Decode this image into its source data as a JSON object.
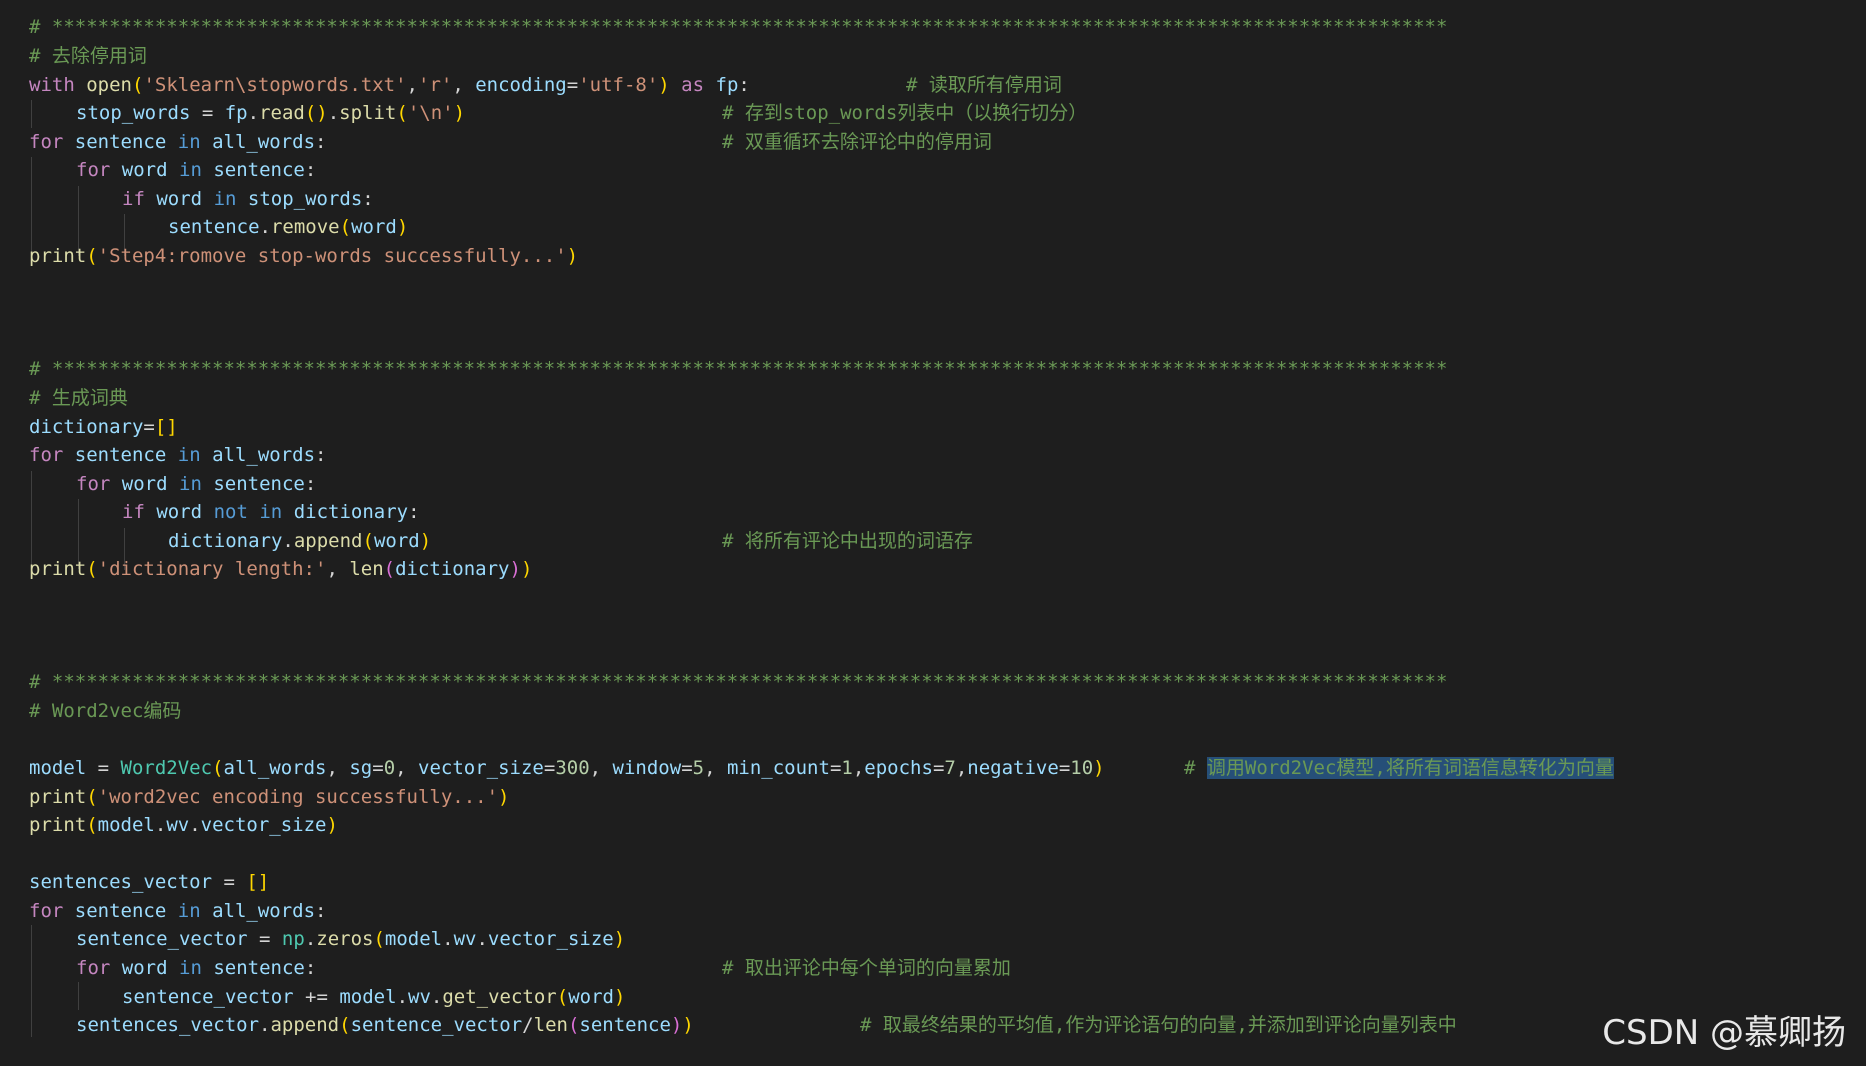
{
  "editor": {
    "language": "python",
    "lines": {
      "l1": "# **************************************************************************************************************************",
      "l2": "# 去除停用词",
      "l3_a": "with",
      "l3_b": "open",
      "l3_c": "'Sklearn\\stopwords.txt'",
      "l3_d": "'r'",
      "l3_e": "encoding",
      "l3_f": "'utf-8'",
      "l3_g": "as",
      "l3_h": "fp",
      "l3_cmt": "# 读取所有停用词",
      "l4_a": "stop_words",
      "l4_b": "fp",
      "l4_c": "read",
      "l4_d": "split",
      "l4_e": "'\\n'",
      "l4_cmt": "# 存到stop_words列表中（以换行切分）",
      "l5_a": "for",
      "l5_b": "sentence",
      "l5_c": "in",
      "l5_d": "all_words",
      "l5_cmt": "# 双重循环去除评论中的停用词",
      "l6_a": "for",
      "l6_b": "word",
      "l6_c": "in",
      "l6_d": "sentence",
      "l7_a": "if",
      "l7_b": "word",
      "l7_c": "in",
      "l7_d": "stop_words",
      "l8_a": "sentence",
      "l8_b": "remove",
      "l8_c": "word",
      "l9_a": "print",
      "l9_b": "'Step4:romove stop-words successfully...'",
      "l10": "# **************************************************************************************************************************",
      "l11": "# 生成词典",
      "l12_a": "dictionary",
      "l13_a": "for",
      "l13_b": "sentence",
      "l13_c": "in",
      "l13_d": "all_words",
      "l14_a": "for",
      "l14_b": "word",
      "l14_c": "in",
      "l14_d": "sentence",
      "l15_a": "if",
      "l15_b": "word",
      "l15_c": "not",
      "l15_d": "in",
      "l15_e": "dictionary",
      "l16_a": "dictionary",
      "l16_b": "append",
      "l16_c": "word",
      "l16_cmt": "# 将所有评论中出现的词语存",
      "l17_a": "print",
      "l17_b": "'dictionary length:'",
      "l17_c": "len",
      "l17_d": "dictionary",
      "l18": "# **************************************************************************************************************************",
      "l19": "# Word2vec编码",
      "l20_a": "model",
      "l20_b": "Word2Vec",
      "l20_c": "all_words",
      "l20_d": "sg",
      "l20_e": "0",
      "l20_f": "vector_size",
      "l20_g": "300",
      "l20_h": "window",
      "l20_i": "5",
      "l20_j": "min_count",
      "l20_k": "1",
      "l20_l": "epochs",
      "l20_m": "7",
      "l20_n": "negative",
      "l20_o": "10",
      "l20_cmt_hash": "#",
      "l20_cmt": "调用Word2Vec模型,将所有词语信息转化为向量",
      "l21_a": "print",
      "l21_b": "'word2vec encoding successfully...'",
      "l22_a": "print",
      "l22_b": "model",
      "l22_c": "wv",
      "l22_d": "vector_size",
      "l23_a": "sentences_vector",
      "l24_a": "for",
      "l24_b": "sentence",
      "l24_c": "in",
      "l24_d": "all_words",
      "l25_a": "sentence_vector",
      "l25_b": "np",
      "l25_c": "zeros",
      "l25_d": "model",
      "l25_e": "wv",
      "l25_f": "vector_size",
      "l26_a": "for",
      "l26_b": "word",
      "l26_c": "in",
      "l26_d": "sentence",
      "l26_cmt": "# 取出评论中每个单词的向量累加",
      "l27_a": "sentence_vector",
      "l27_b": "model",
      "l27_c": "wv",
      "l27_d": "get_vector",
      "l27_e": "word",
      "l28_a": "sentences_vector",
      "l28_b": "append",
      "l28_c": "sentence_vector",
      "l28_d": "len",
      "l28_e": "sentence",
      "l28_cmt": "# 取最终结果的平均值,作为评论语句的向量,并添加到评论向量列表中"
    }
  },
  "watermark": "CSDN @慕卿扬"
}
